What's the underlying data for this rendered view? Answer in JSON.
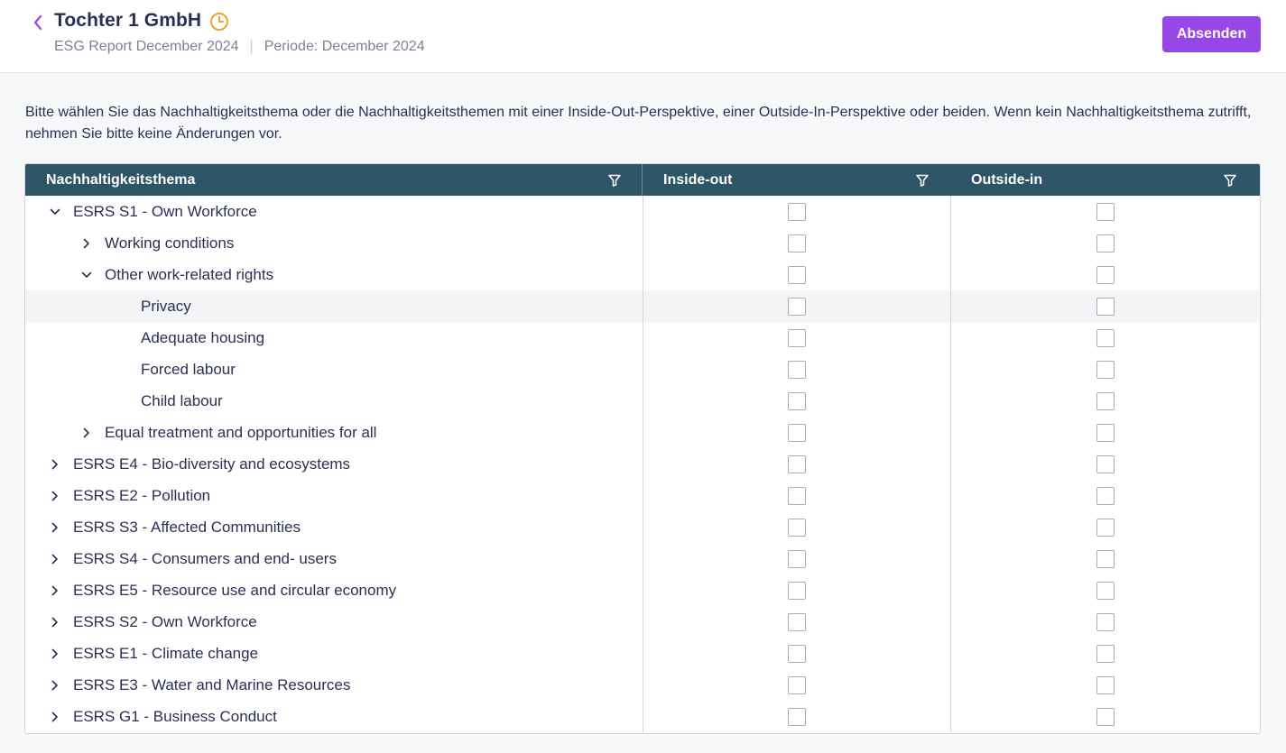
{
  "header": {
    "title": "Tochter 1 GmbH",
    "report": "ESG Report December 2024",
    "separator": "|",
    "period": "Periode: December 2024",
    "submit_label": "Absenden"
  },
  "instructions": "Bitte wählen Sie das Nachhaltigkeitsthema oder die Nachhaltigkeitsthemen mit einer Inside-Out-Perspektive, einer Outside-In-Perspektive oder beiden. Wenn kein Nachhaltigkeitsthema zutrifft, nehmen Sie bitte keine Änderungen vor.",
  "table": {
    "columns": [
      "Nachhaltigkeitsthema",
      "Inside-out",
      "Outside-in"
    ],
    "rows": [
      {
        "label": "ESRS S1 - Own Workforce",
        "level": 0,
        "state": "expanded",
        "inside": false,
        "outside": false
      },
      {
        "label": "Working conditions",
        "level": 1,
        "state": "collapsed",
        "inside": false,
        "outside": false
      },
      {
        "label": "Other work-related rights",
        "level": 1,
        "state": "expanded",
        "inside": false,
        "outside": false
      },
      {
        "label": "Privacy",
        "level": 2,
        "state": "leaf",
        "highlighted": true,
        "inside": false,
        "outside": false
      },
      {
        "label": "Adequate housing",
        "level": 2,
        "state": "leaf",
        "inside": false,
        "outside": false
      },
      {
        "label": "Forced labour",
        "level": 2,
        "state": "leaf",
        "inside": false,
        "outside": false
      },
      {
        "label": "Child labour",
        "level": 2,
        "state": "leaf",
        "inside": false,
        "outside": false
      },
      {
        "label": "Equal treatment and opportunities for all",
        "level": 1,
        "state": "collapsed",
        "inside": false,
        "outside": false
      },
      {
        "label": "ESRS E4 - Bio-diversity and ecosystems",
        "level": 0,
        "state": "collapsed",
        "inside": false,
        "outside": false
      },
      {
        "label": "ESRS E2 - Pollution",
        "level": 0,
        "state": "collapsed",
        "inside": false,
        "outside": false
      },
      {
        "label": "ESRS S3 - Affected Communities",
        "level": 0,
        "state": "collapsed",
        "inside": false,
        "outside": false
      },
      {
        "label": "ESRS S4 - Consumers and end- users",
        "level": 0,
        "state": "collapsed",
        "inside": false,
        "outside": false
      },
      {
        "label": "ESRS E5 - Resource use and circular economy",
        "level": 0,
        "state": "collapsed",
        "inside": false,
        "outside": false
      },
      {
        "label": "ESRS S2 - Own Workforce",
        "level": 0,
        "state": "collapsed",
        "inside": false,
        "outside": false
      },
      {
        "label": "ESRS E1 - Climate change",
        "level": 0,
        "state": "collapsed",
        "inside": false,
        "outside": false
      },
      {
        "label": "ESRS E3 - Water and Marine Resources",
        "level": 0,
        "state": "collapsed",
        "inside": false,
        "outside": false
      },
      {
        "label": "ESRS G1 - Business Conduct",
        "level": 0,
        "state": "collapsed",
        "inside": false,
        "outside": false
      }
    ]
  },
  "colors": {
    "accent": "#9747e6",
    "header_bg": "#2e5468",
    "clock": "#f0a52b",
    "text": "#2b2f55"
  },
  "icons": {
    "back": "chevron-left-icon",
    "status": "clock-icon",
    "filter": "filter-icon",
    "expanded": "chevron-down-icon",
    "collapsed": "chevron-right-icon"
  }
}
